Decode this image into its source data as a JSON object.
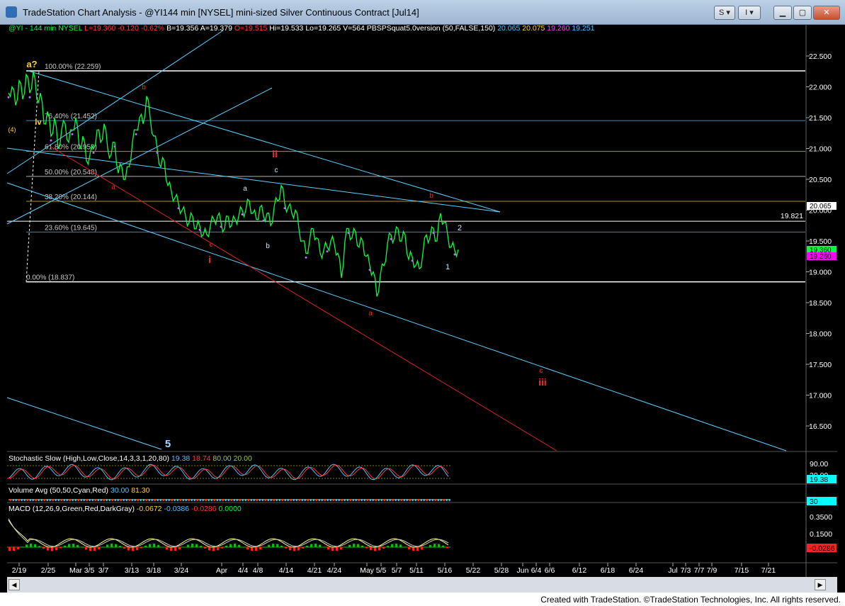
{
  "window": {
    "title": "TradeStation Chart Analysis - @YI144 min [NYSEL] mini-sized Silver Continuous Contract [Jul14]",
    "buttons": [
      "S",
      "I"
    ]
  },
  "header": {
    "symbol": "@YI - 144 min",
    "exchange": "NYSEL",
    "last": "L=19.360",
    "change": "-0.120",
    "pct": "-0.62%",
    "bid": "B=19.356",
    "ask": "A=19.379",
    "open": "O=19.515",
    "hi": "Hi=19.533",
    "lo": "Lo=19.265",
    "vol": "V=564",
    "indicator": "PBSPSquat5.0version (50,FALSE,150)",
    "ind_vals": [
      "20.065",
      "20.075",
      "19.260",
      "19.251"
    ]
  },
  "chart_data": {
    "type": "line",
    "title": "",
    "price_ticks": [
      "22.500",
      "22.000",
      "21.500",
      "21.000",
      "20.500",
      "20.000",
      "19.500",
      "19.000",
      "18.500",
      "18.000",
      "17.500",
      "17.000",
      "16.500"
    ],
    "date_ticks": [
      "2/19",
      "2/25",
      "Mar",
      "3/5",
      "3/7",
      "3/13",
      "3/18",
      "3/24",
      "Apr",
      "4/4",
      "4/8",
      "4/14",
      "4/21",
      "4/24",
      "May",
      "5/5",
      "5/7",
      "5/11",
      "5/16",
      "5/22",
      "5/28",
      "Jun",
      "6/4",
      "6/6",
      "6/12",
      "6/18",
      "6/24",
      "Jul",
      "7/3",
      "7/7",
      "7/9",
      "7/15",
      "7/21"
    ],
    "price_series": {
      "name": "@YI",
      "points": [
        [
          0,
          21.9
        ],
        [
          5,
          22.0
        ],
        [
          10,
          21.7
        ],
        [
          15,
          22.1
        ],
        [
          20,
          21.8
        ],
        [
          25,
          22.2
        ],
        [
          30,
          21.9
        ],
        [
          35,
          22.25
        ],
        [
          40,
          21.8
        ],
        [
          45,
          21.9
        ],
        [
          50,
          21.4
        ],
        [
          55,
          21.6
        ],
        [
          60,
          21.2
        ],
        [
          65,
          21.5
        ],
        [
          70,
          21.0
        ],
        [
          75,
          21.3
        ],
        [
          80,
          21.4
        ],
        [
          85,
          21.1
        ],
        [
          90,
          21.3
        ],
        [
          95,
          21.5
        ],
        [
          100,
          21.0
        ],
        [
          105,
          21.2
        ],
        [
          110,
          20.8
        ],
        [
          115,
          20.9
        ],
        [
          120,
          21.0
        ],
        [
          125,
          21.3
        ],
        [
          130,
          21.1
        ],
        [
          135,
          21.4
        ],
        [
          140,
          21.0
        ],
        [
          145,
          20.9
        ],
        [
          150,
          21.1
        ],
        [
          155,
          20.6
        ],
        [
          160,
          20.7
        ],
        [
          165,
          20.5
        ],
        [
          170,
          20.7
        ],
        [
          175,
          21.1
        ],
        [
          180,
          21.3
        ],
        [
          185,
          21.5
        ],
        [
          190,
          21.4
        ],
        [
          195,
          21.85
        ],
        [
          200,
          21.5
        ],
        [
          205,
          21.2
        ],
        [
          210,
          21.0
        ],
        [
          215,
          20.7
        ],
        [
          220,
          20.8
        ],
        [
          225,
          20.4
        ],
        [
          230,
          20.3
        ],
        [
          235,
          20.2
        ],
        [
          240,
          20.1
        ],
        [
          245,
          20.0
        ],
        [
          250,
          19.9
        ],
        [
          255,
          19.8
        ],
        [
          260,
          19.9
        ],
        [
          265,
          19.7
        ],
        [
          270,
          19.75
        ],
        [
          275,
          19.6
        ],
        [
          280,
          19.6
        ],
        [
          285,
          19.75
        ],
        [
          290,
          19.85
        ],
        [
          295,
          19.9
        ],
        [
          300,
          19.8
        ],
        [
          305,
          19.7
        ],
        [
          310,
          19.9
        ],
        [
          315,
          19.75
        ],
        [
          320,
          19.85
        ],
        [
          325,
          19.9
        ],
        [
          330,
          20.0
        ],
        [
          335,
          20.0
        ],
        [
          340,
          20.15
        ],
        [
          345,
          19.95
        ],
        [
          350,
          19.85
        ],
        [
          355,
          20.05
        ],
        [
          360,
          19.9
        ],
        [
          365,
          19.95
        ],
        [
          370,
          19.75
        ],
        [
          375,
          20.05
        ],
        [
          380,
          20.15
        ],
        [
          385,
          20.4
        ],
        [
          390,
          20.1
        ],
        [
          395,
          20.05
        ],
        [
          400,
          19.95
        ],
        [
          405,
          20.0
        ],
        [
          410,
          19.7
        ],
        [
          415,
          19.5
        ],
        [
          420,
          19.3
        ],
        [
          425,
          19.5
        ],
        [
          430,
          19.7
        ],
        [
          435,
          19.55
        ],
        [
          440,
          19.3
        ],
        [
          445,
          19.35
        ],
        [
          450,
          19.4
        ],
        [
          455,
          19.5
        ],
        [
          460,
          19.45
        ],
        [
          465,
          19.3
        ],
        [
          470,
          18.9
        ],
        [
          475,
          19.5
        ],
        [
          480,
          19.7
        ],
        [
          485,
          19.55
        ],
        [
          490,
          19.65
        ],
        [
          495,
          19.4
        ],
        [
          500,
          19.5
        ],
        [
          505,
          19.25
        ],
        [
          510,
          19.1
        ],
        [
          515,
          19.0
        ],
        [
          520,
          18.6
        ],
        [
          525,
          18.95
        ],
        [
          530,
          19.1
        ],
        [
          535,
          19.45
        ],
        [
          540,
          19.6
        ],
        [
          545,
          19.55
        ],
        [
          550,
          19.7
        ],
        [
          555,
          19.5
        ],
        [
          560,
          19.6
        ],
        [
          565,
          19.2
        ],
        [
          570,
          19.25
        ],
        [
          575,
          19.1
        ],
        [
          580,
          19.05
        ],
        [
          585,
          19.3
        ],
        [
          590,
          19.6
        ],
        [
          595,
          19.55
        ],
        [
          600,
          19.7
        ],
        [
          605,
          19.5
        ],
        [
          610,
          19.95
        ],
        [
          615,
          19.8
        ],
        [
          620,
          19.6
        ],
        [
          625,
          19.4
        ],
        [
          630,
          19.35
        ],
        [
          635,
          19.36
        ]
      ]
    },
    "fib_levels": [
      {
        "label": "100.00% (22.259)",
        "value": 22.259
      },
      {
        "label": "76.40% (21.452)",
        "value": 21.452
      },
      {
        "label": "61.80% (20.952)",
        "value": 20.952
      },
      {
        "label": "50.00% (20.548)",
        "value": 20.548
      },
      {
        "label": "38.20% (20.144)",
        "value": 20.144
      },
      {
        "label": "23.60% (19.645)",
        "value": 19.645
      },
      {
        "label": "0.00% (18.837)",
        "value": 18.837
      }
    ],
    "level_19821": "19.821",
    "wave_labels": [
      {
        "t": "a?",
        "color": "#ffd23a",
        "bold": true,
        "size": 13
      },
      {
        "t": "iv",
        "color": "#ffd23a",
        "bold": true,
        "size": 11
      },
      {
        "t": "(4)",
        "color": "#ffd23a",
        "bold": false,
        "size": 9
      },
      {
        "t": "b",
        "color": "#ff2020",
        "bold": false,
        "size": 10
      },
      {
        "t": "a",
        "color": "#ff2020",
        "bold": false,
        "size": 10
      },
      {
        "t": "c",
        "color": "#ff2020",
        "bold": false,
        "size": 10
      },
      {
        "t": "i",
        "color": "#ff2020",
        "bold": true,
        "size": 14
      },
      {
        "t": "ii",
        "color": "#ff2020",
        "bold": true,
        "size": 14
      },
      {
        "t": "c",
        "color": "#cfe6ff",
        "bold": false,
        "size": 10
      },
      {
        "t": "a",
        "color": "#cfe6ff",
        "bold": false,
        "size": 10
      },
      {
        "t": "b",
        "color": "#cfe6ff",
        "bold": false,
        "size": 10
      },
      {
        "t": "b",
        "color": "#ff2020",
        "bold": false,
        "size": 10
      },
      {
        "t": "a",
        "color": "#ff2020",
        "bold": false,
        "size": 10
      },
      {
        "t": "2",
        "color": "#cfe6ff",
        "bold": false,
        "size": 11
      },
      {
        "t": "1",
        "color": "#cfe6ff",
        "bold": false,
        "size": 11
      },
      {
        "t": "c",
        "color": "#ff2020",
        "bold": false,
        "size": 10
      },
      {
        "t": "iii",
        "color": "#ff2020",
        "bold": true,
        "size": 14
      },
      {
        "t": "5",
        "color": "#a9d4ff",
        "bold": true,
        "size": 15
      }
    ],
    "axis_boxes": [
      {
        "value": "20.065",
        "bg": "#ffffff",
        "fg": "#000000"
      },
      {
        "value": "19.360",
        "bg": "#00ff40",
        "fg": "#000000"
      },
      {
        "value": "19.260",
        "bg": "#ff00ff",
        "fg": "#000000"
      }
    ],
    "stochastic": {
      "title": "Stochastic Slow (High,Low,Close,14,3,3,1,20,80)",
      "vals": [
        "19.38",
        "18.74",
        "80.00",
        "20.00"
      ],
      "axis": [
        "90.00",
        "20.00"
      ],
      "box": "19.38"
    },
    "volume": {
      "title": "Volume Avg (50,50,Cyan,Red)",
      "vals": [
        "30.00",
        "81.30"
      ],
      "box": "30"
    },
    "macd": {
      "title": "MACD (12,26,9,Green,Red,DarkGray)",
      "vals": [
        "-0.0672",
        "-0.0386",
        "-0.0286",
        "0.0000"
      ],
      "axis": [
        "0.3500",
        "0.1500"
      ],
      "box": "-0.0286"
    }
  },
  "footer": {
    "text": "Created with TradeStation. ©TradeStation Technologies, Inc. All rights reserved."
  }
}
